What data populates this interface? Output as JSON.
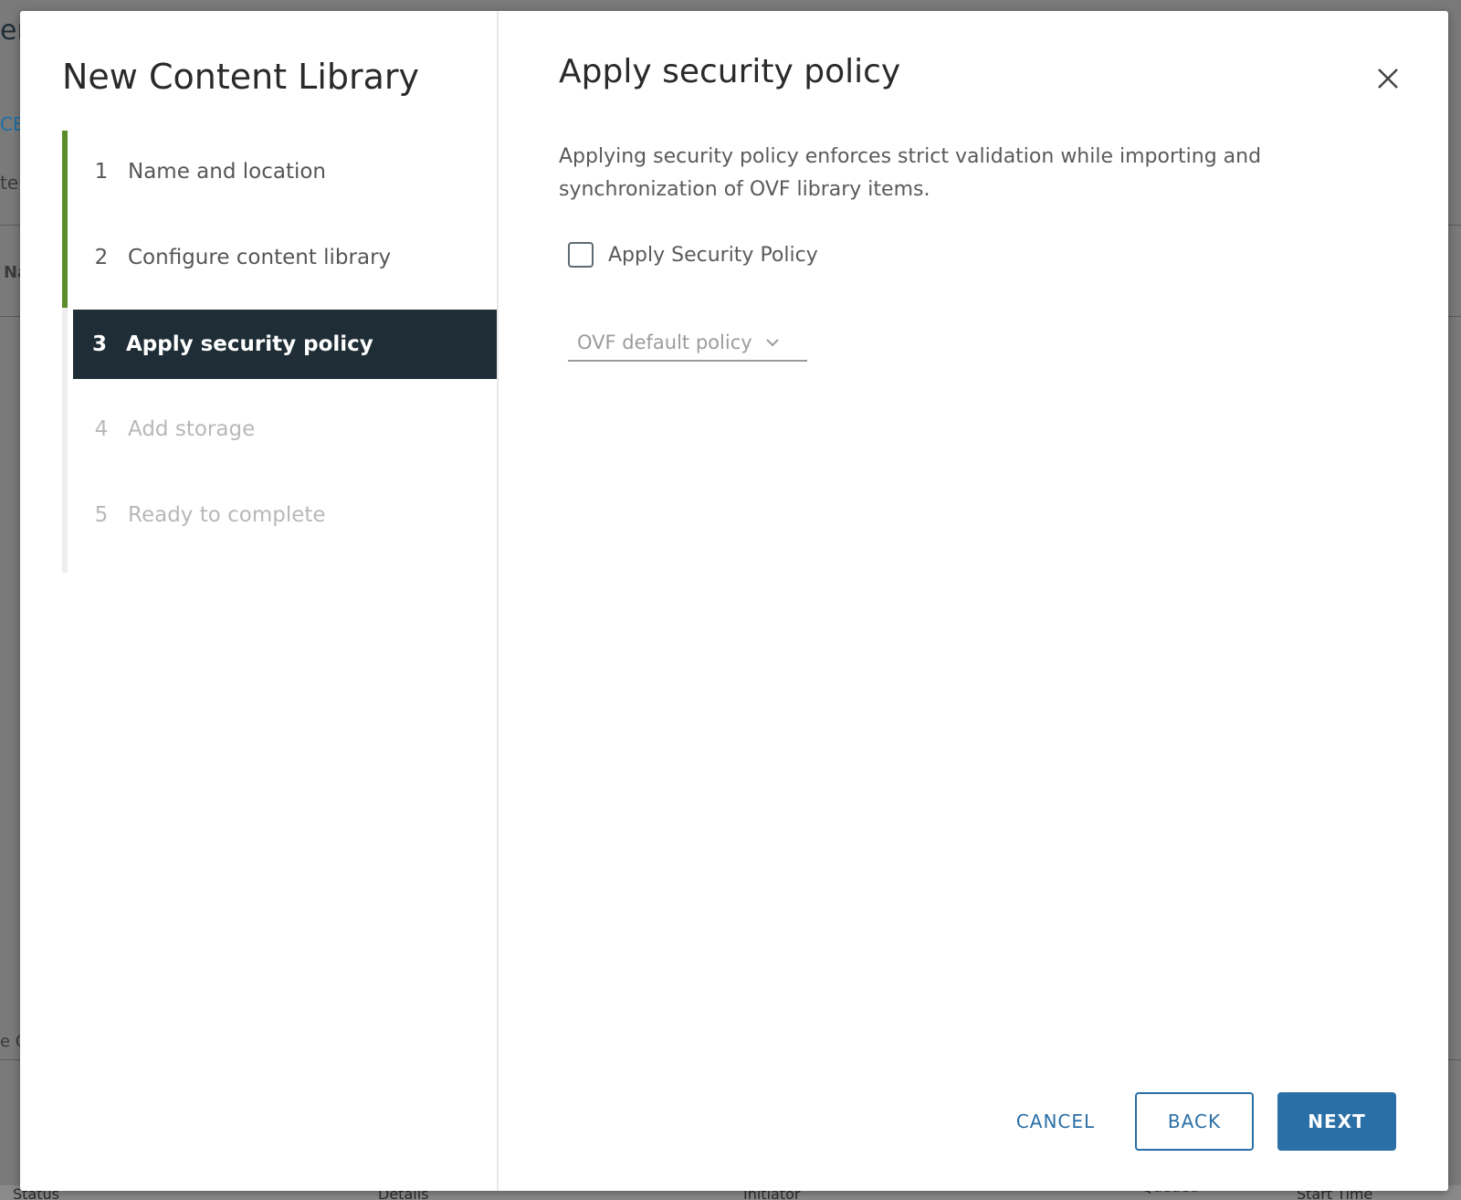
{
  "background": {
    "fragment_top": "er",
    "fragment_link": "CE",
    "fragment_input": "te",
    "fragment_col": "Na",
    "fragment_tab": "e C",
    "columns": [
      "Status",
      "Details",
      "Initiator",
      "Queued",
      "Start Time"
    ]
  },
  "wizard": {
    "title": "New Content Library",
    "steps": [
      {
        "num": "1",
        "label": "Name and location",
        "state": "completed"
      },
      {
        "num": "2",
        "label": "Configure content library",
        "state": "completed"
      },
      {
        "num": "3",
        "label": "Apply security policy",
        "state": "active"
      },
      {
        "num": "4",
        "label": "Add storage",
        "state": "disabled"
      },
      {
        "num": "5",
        "label": "Ready to complete",
        "state": "disabled"
      }
    ]
  },
  "page": {
    "title": "Apply security policy",
    "description": "Applying security policy enforces strict validation while importing and synchronization of OVF library items.",
    "checkbox_label": "Apply Security Policy",
    "checkbox_checked": false,
    "policy_select_value": "OVF default policy"
  },
  "footer": {
    "cancel_label": "CANCEL",
    "back_label": "BACK",
    "next_label": "NEXT"
  },
  "colors": {
    "active_step_bg": "#1f2d36",
    "completed_track": "#5b8c2a",
    "primary": "#2a6fa6"
  },
  "icons": {
    "close": "close-icon",
    "dropdown": "chevron-down-icon"
  }
}
